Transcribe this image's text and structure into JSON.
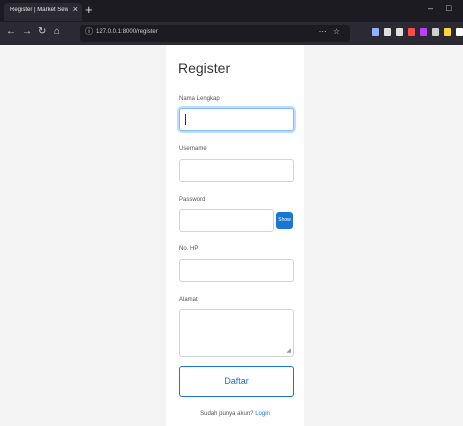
{
  "browser": {
    "tab_title": "Register | Market Sewa",
    "tab_close": "×",
    "new_tab": "+",
    "win_min": "–",
    "win_max": "□",
    "nav_back": "←",
    "nav_forward": "→",
    "nav_reload": "↻",
    "nav_home": "⌂",
    "url": "127.0.0.1:8000/register",
    "url_lock": "ⓘ",
    "url_actions": "⋯ ☆"
  },
  "form": {
    "title": "Register",
    "name_label": "Nama Lengkap",
    "username_label": "Username",
    "password_label": "Password",
    "show_label": "Show",
    "phone_label": "No. HP",
    "address_label": "Alamat",
    "submit_label": "Daftar",
    "login_prompt": "Sudah punya akun?",
    "login_link": "Login"
  },
  "toolbar_icon_colors": [
    "#8fb3ff",
    "#e0e0e0",
    "#e0e0e0",
    "#ff4a4a",
    "#c23cff",
    "#d0d0d0",
    "#ffd23f",
    "#ffffff"
  ]
}
